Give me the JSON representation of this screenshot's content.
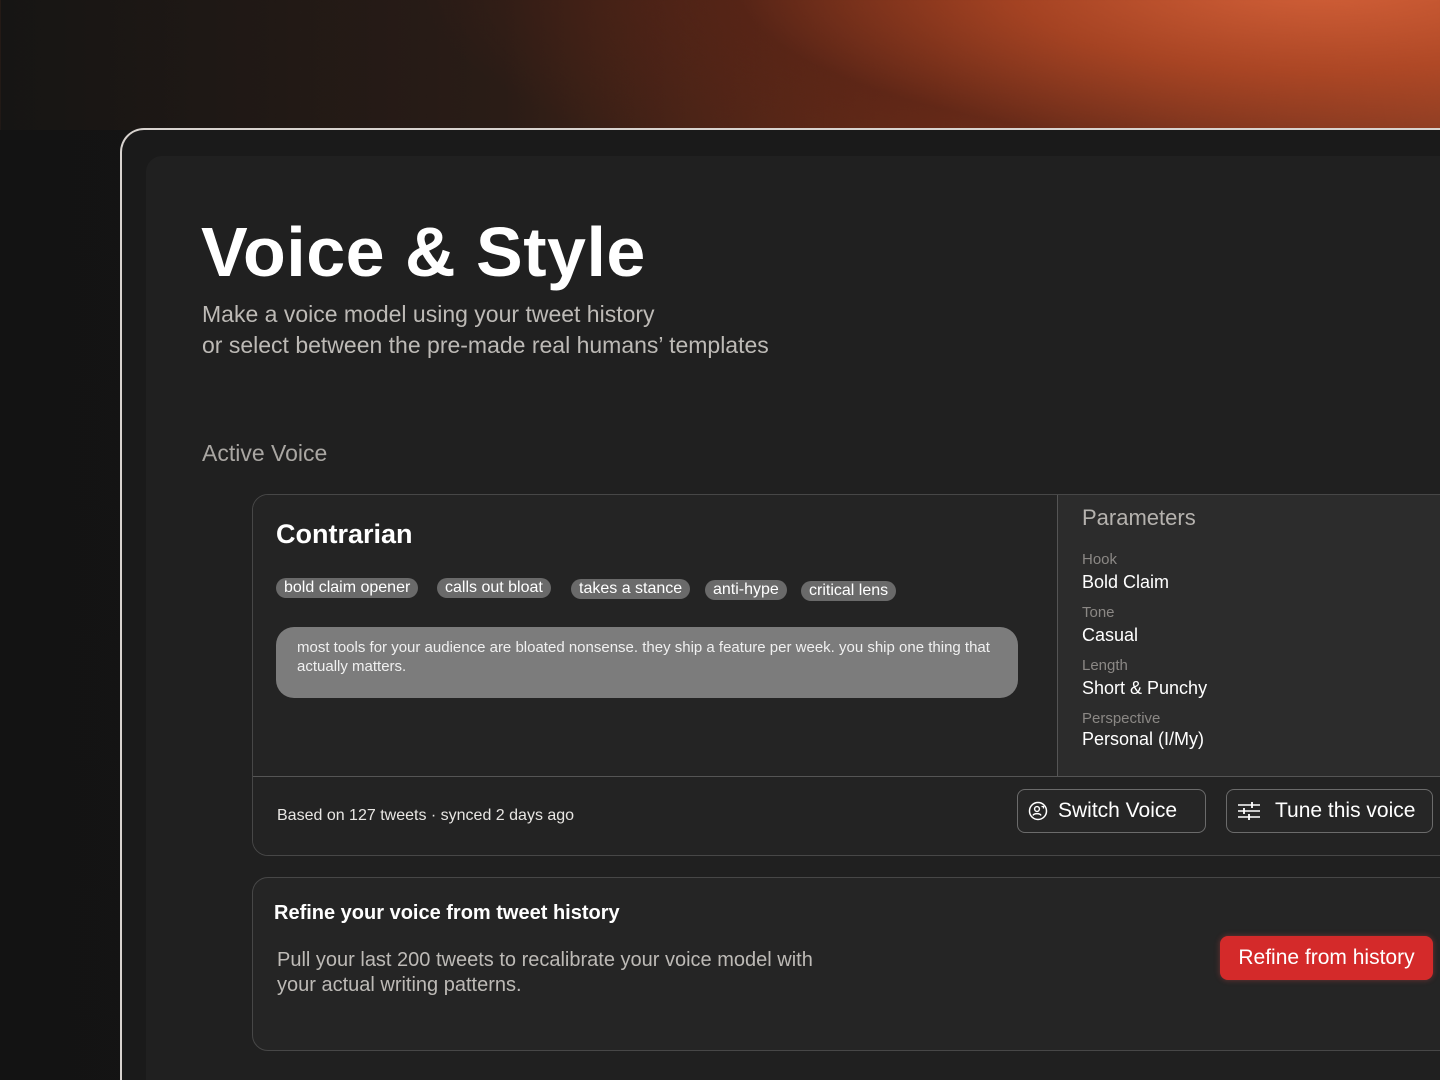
{
  "page": {
    "title": "Voice & Style",
    "subtitle_line1": "Make a voice model using your tweet history",
    "subtitle_line2": "or select between the pre-made real humans’ templates",
    "section_label": "Active Voice"
  },
  "voice": {
    "name": "Contrarian",
    "tags": [
      "bold claim opener",
      "calls out bloat",
      "takes a stance",
      "anti-hype",
      "critical lens"
    ],
    "sample": "most tools for your audience are bloated nonsense. they ship a feature per week. you ship one thing that actually matters.",
    "footer_meta": "Based on 127 tweets · synced 2 days ago",
    "switch_label": "Switch Voice",
    "tune_label": "Tune this voice"
  },
  "parameters": {
    "title": "Parameters",
    "items": [
      {
        "label": "Hook",
        "value": "Bold Claim"
      },
      {
        "label": "Tone",
        "value": "Casual"
      },
      {
        "label": "Length",
        "value": "Short & Punchy"
      },
      {
        "label": "Perspective",
        "value": "Personal (I/My)"
      }
    ]
  },
  "refine": {
    "title": "Refine your voice from tweet history",
    "description": "Pull your last 200 tweets to recalibrate your voice model with your actual writing patterns.",
    "button_label": "Refine from history"
  },
  "colors": {
    "accent_red": "#d42a2a",
    "gradient_orange": "#cf6136"
  },
  "icons": {
    "switch": "user-switch-icon",
    "tune": "sliders-icon"
  }
}
